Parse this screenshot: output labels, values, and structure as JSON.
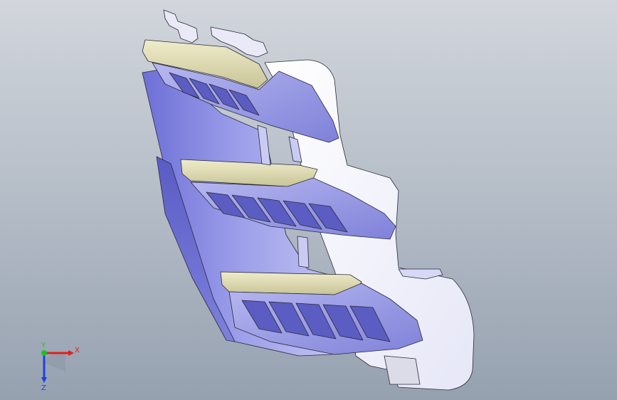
{
  "viewport": {
    "background_top": "#d2d6dc",
    "background_bottom": "#96a1b0",
    "model_body_color": "#8e90e2",
    "model_shell_color": "#ffffff",
    "model_trim_color": "#dcd8ad"
  },
  "triad": {
    "x_label": "X",
    "y_label": "Y",
    "z_label": "Z",
    "x_color": "#e02020",
    "y_color": "#20c020",
    "z_color": "#2040e0"
  }
}
